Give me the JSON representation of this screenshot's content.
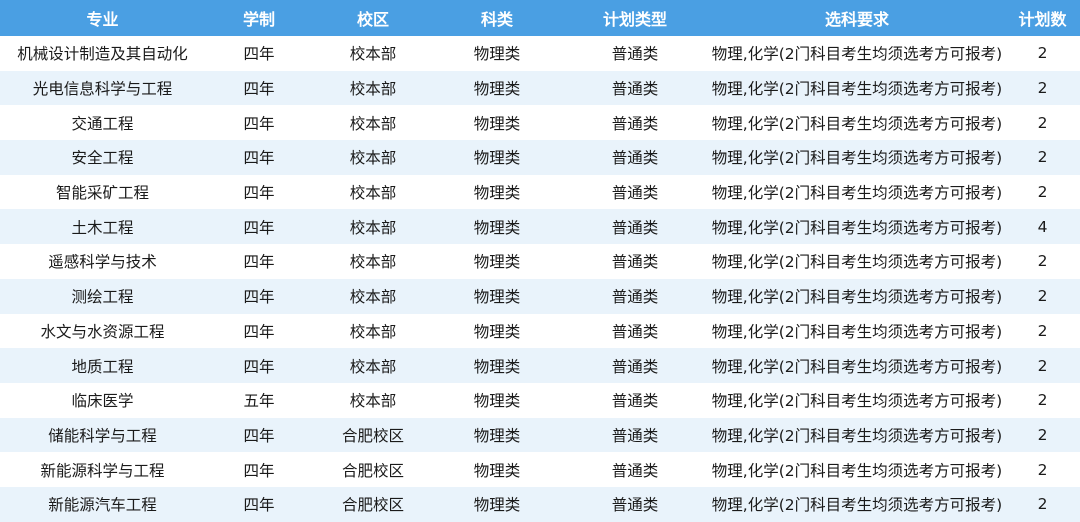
{
  "table": {
    "headers": [
      "专业",
      "学制",
      "校区",
      "科类",
      "计划类型",
      "选科要求",
      "计划数"
    ],
    "rows": [
      [
        "机械设计制造及其自动化",
        "四年",
        "校本部",
        "物理类",
        "普通类",
        "物理,化学(2门科目考生均须选考方可报考)",
        "2"
      ],
      [
        "光电信息科学与工程",
        "四年",
        "校本部",
        "物理类",
        "普通类",
        "物理,化学(2门科目考生均须选考方可报考)",
        "2"
      ],
      [
        "交通工程",
        "四年",
        "校本部",
        "物理类",
        "普通类",
        "物理,化学(2门科目考生均须选考方可报考)",
        "2"
      ],
      [
        "安全工程",
        "四年",
        "校本部",
        "物理类",
        "普通类",
        "物理,化学(2门科目考生均须选考方可报考)",
        "2"
      ],
      [
        "智能采矿工程",
        "四年",
        "校本部",
        "物理类",
        "普通类",
        "物理,化学(2门科目考生均须选考方可报考)",
        "2"
      ],
      [
        "土木工程",
        "四年",
        "校本部",
        "物理类",
        "普通类",
        "物理,化学(2门科目考生均须选考方可报考)",
        "4"
      ],
      [
        "遥感科学与技术",
        "四年",
        "校本部",
        "物理类",
        "普通类",
        "物理,化学(2门科目考生均须选考方可报考)",
        "2"
      ],
      [
        "测绘工程",
        "四年",
        "校本部",
        "物理类",
        "普通类",
        "物理,化学(2门科目考生均须选考方可报考)",
        "2"
      ],
      [
        "水文与水资源工程",
        "四年",
        "校本部",
        "物理类",
        "普通类",
        "物理,化学(2门科目考生均须选考方可报考)",
        "2"
      ],
      [
        "地质工程",
        "四年",
        "校本部",
        "物理类",
        "普通类",
        "物理,化学(2门科目考生均须选考方可报考)",
        "2"
      ],
      [
        "临床医学",
        "五年",
        "校本部",
        "物理类",
        "普通类",
        "物理,化学(2门科目考生均须选考方可报考)",
        "2"
      ],
      [
        "储能科学与工程",
        "四年",
        "合肥校区",
        "物理类",
        "普通类",
        "物理,化学(2门科目考生均须选考方可报考)",
        "2"
      ],
      [
        "新能源科学与工程",
        "四年",
        "合肥校区",
        "物理类",
        "普通类",
        "物理,化学(2门科目考生均须选考方可报考)",
        "2"
      ],
      [
        "新能源汽车工程",
        "四年",
        "合肥校区",
        "物理类",
        "普通类",
        "物理,化学(2门科目考生均须选考方可报考)",
        "2"
      ]
    ]
  }
}
